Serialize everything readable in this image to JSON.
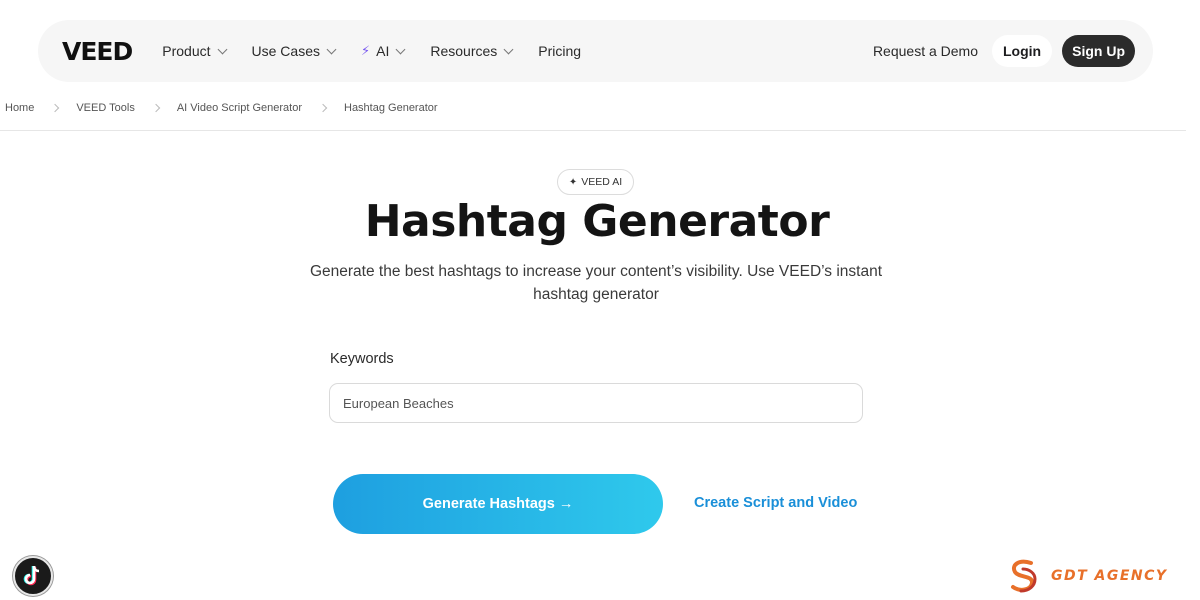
{
  "nav": {
    "logo": "VEED",
    "items": [
      {
        "label": "Product",
        "dropdown": true
      },
      {
        "label": "Use Cases",
        "dropdown": true
      },
      {
        "label": "AI",
        "dropdown": true,
        "icon": "bolt-icon"
      },
      {
        "label": "Resources",
        "dropdown": true
      },
      {
        "label": "Pricing",
        "dropdown": false
      }
    ],
    "request_demo": "Request a Demo",
    "login": "Login",
    "signup": "Sign Up"
  },
  "breadcrumb": [
    "Home",
    "VEED Tools",
    "AI Video Script Generator",
    "Hashtag Generator"
  ],
  "hero": {
    "badge": "VEED AI",
    "title": "Hashtag Generator",
    "subtitle": "Generate the best hashtags to increase your content’s visibility. Use VEED’s instant hashtag generator"
  },
  "form": {
    "keywords_label": "Keywords",
    "keywords_value": "European Beaches",
    "generate_label": "Generate Hashtags →",
    "create_link": "Create Script and Video"
  },
  "watermark": {
    "agency": "GDT AGENCY"
  },
  "colors": {
    "accent_gradient_start": "#1e9fe0",
    "accent_gradient_end": "#2fc9ec",
    "link": "#1a8fd8",
    "agency_orange": "#e8702a"
  }
}
